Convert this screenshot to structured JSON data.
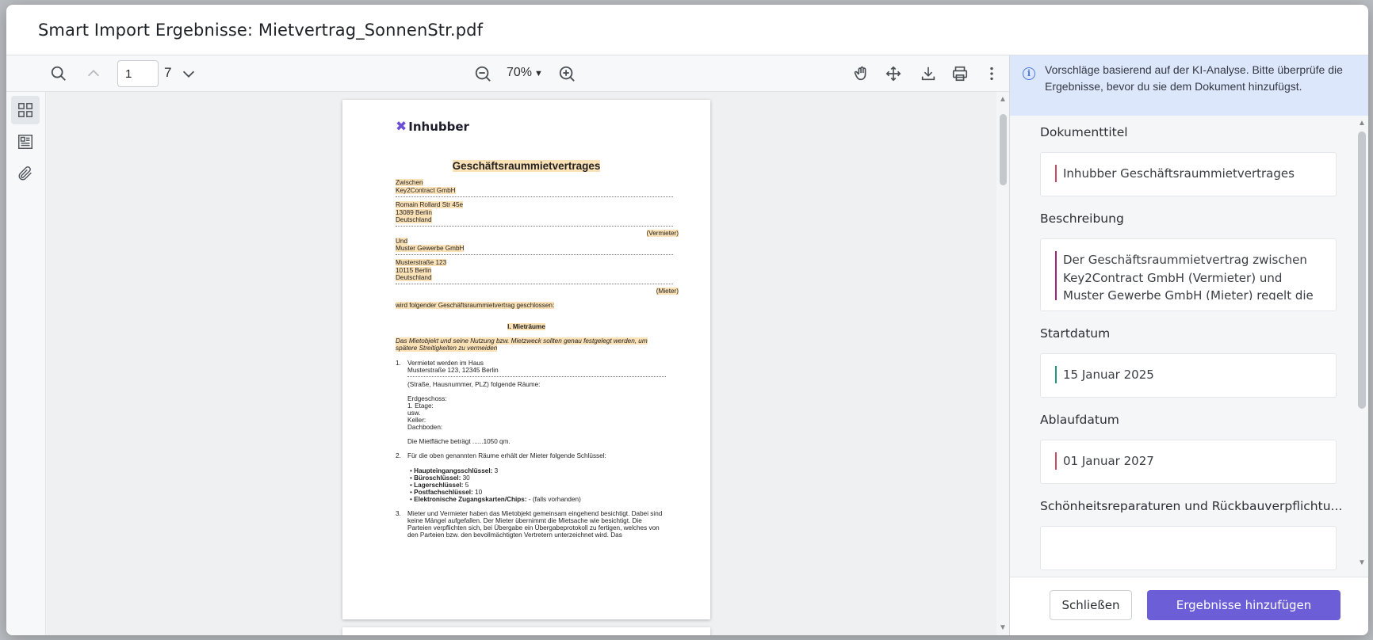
{
  "modal": {
    "title": "Smart Import Ergebnisse: Mietvertrag_SonnenStr.pdf"
  },
  "toolbar": {
    "page_value": "1",
    "page_total": "7",
    "zoom": "70%"
  },
  "document": {
    "logo": "Inhubber",
    "title": "Geschäftsraummietvertrages",
    "lines": {
      "zwischen": "Zwischen",
      "landlord_name": "Key2Contract GmbH",
      "landlord_street": "Romain Rollard Str 45e",
      "landlord_city": "13089 Berlin",
      "landlord_country": "Deutschland",
      "vermieter": "(Vermieter)",
      "und": "Und",
      "tenant_name": "Muster Gewerbe GmbH",
      "tenant_street": "Musterstraße 123",
      "tenant_city": "10115 Berlin",
      "tenant_country": "Deutschland",
      "mieter": "(Mieter)",
      "closing": "wird folgender Geschäftsraummietvertrag geschlossen:",
      "section": "I. Mieträume",
      "note1": "Das Mietobjekt und seine Nutzung bzw. Mietzweck sollten genau festgelegt werden, um",
      "note2": "spätere Streitigkeiten zu vermeiden",
      "n1": "1.",
      "item1a": "Vermietet werden im Haus",
      "item1b": "Musterstraße 123, 12345 Berlin",
      "item1c": "(Straße, Hausnummer, PLZ) folgende Räume:",
      "erd": "Erdgeschoss:",
      "etage": "1.   Etage:",
      "usw": "usw.",
      "keller": "Keller:",
      "dach": "Dachboden:",
      "flaeche": "Die Mietfläche beträgt ......1050 qm.",
      "n2": "2.",
      "item2": "Für die oben genannten Räume erhält der Mieter folgende Schlüssel:",
      "k1b": "Haupteingangsschlüssel:",
      "k1v": " 3",
      "k2b": "Büroschlüssel:",
      "k2v": " 30",
      "k3b": "Lagerschlüssel:",
      "k3v": " 5",
      "k4b": "Postfachschlüssel:",
      "k4v": " 10",
      "k5b": "Elektronische Zugangskarten/Chips:",
      "k5v": " - (falls vorhanden)",
      "n3": "3.",
      "p3a": "Mieter und Vermieter haben das Mietobjekt gemeinsam eingehend besichtigt. Dabei sind",
      "p3b": "keine Mängel aufgefallen. Der Mieter übernimmt die Mietsache wie besichtigt. Die",
      "p3c": "Parteien verpflichten sich, bei Übergabe ein Übergabeprotokoll zu fertigen, welches von",
      "p3d": "den Parteien bzw. den bevollmächtigten Vertretern unterzeichnet wird. Das"
    }
  },
  "panel": {
    "info": "Vorschläge basierend auf der KI-Analyse. Bitte überprüfe die Ergebnisse, bevor du sie dem Dokument hinzufügst.",
    "fields": [
      {
        "label": "Dokumenttitel",
        "value": "Inhubber Geschäftsraummietvertrages",
        "accent": "#c94a62"
      },
      {
        "label": "Beschreibung",
        "value": "Der Geschäftsraummietvertrag zwischen Key2Contract GmbH (Vermieter) und Muster Gewerbe GmbH (Mieter) regelt die",
        "accent": "#a1227a"
      },
      {
        "label": "Startdatum",
        "value": "15 Januar 2025",
        "accent": "#1e9a80"
      },
      {
        "label": "Ablaufdatum",
        "value": "01 Januar 2027",
        "accent": "#c94a62"
      },
      {
        "label": "Schönheitsreparaturen und Rückbauverpflichtu...",
        "value": "",
        "accent": "#c94a62"
      }
    ],
    "close_label": "Schließen",
    "add_label": "Ergebnisse hinzufügen"
  },
  "colors": {
    "primary": "#6b5ed6",
    "info_bg": "#dde7fb",
    "highlight": "#fbe1b6"
  }
}
